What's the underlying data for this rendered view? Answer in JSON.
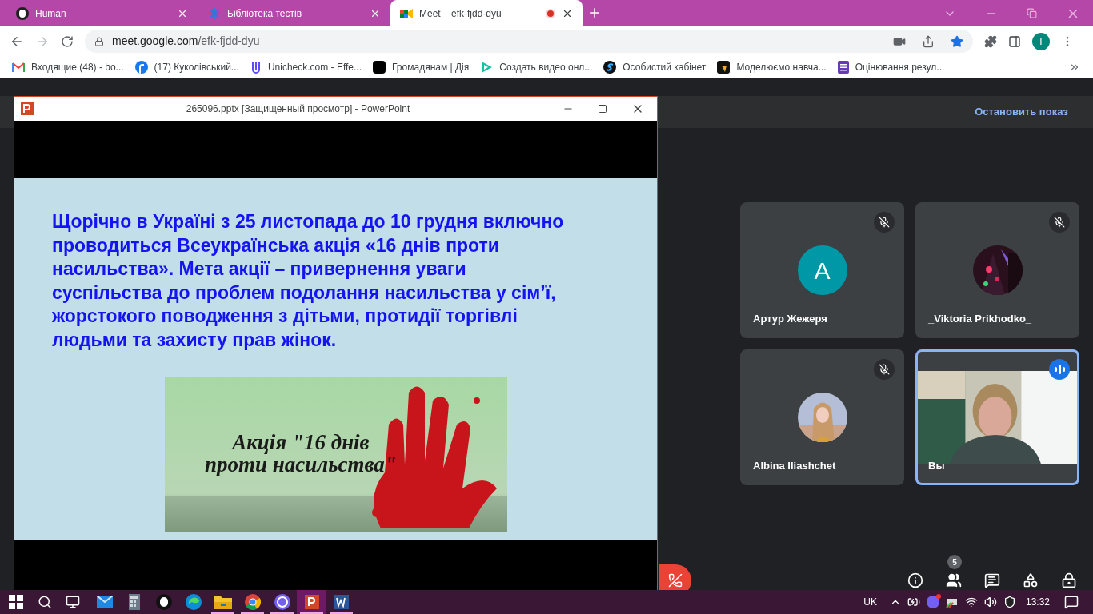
{
  "browser": {
    "tabs": [
      {
        "title": "Human",
        "selected": false,
        "recording": false
      },
      {
        "title": "Бібліотека тестів",
        "selected": false,
        "recording": false
      },
      {
        "title": "Meet – efk-fjdd-dyu",
        "selected": true,
        "recording": true
      }
    ],
    "address": {
      "host": "meet.google.com",
      "path": "/efk-fjdd-dyu"
    },
    "profile_initial": "T",
    "bookmarks": [
      {
        "label": "Входящие (48) - bo..."
      },
      {
        "label": "(17) Куколівський..."
      },
      {
        "label": "Unicheck.com - Effe..."
      },
      {
        "label": "Громадянам | Дія"
      },
      {
        "label": "Создать видео онл..."
      },
      {
        "label": "Особистий кабінет"
      },
      {
        "label": "Моделюємо навча..."
      },
      {
        "label": "Оцінювання резул..."
      }
    ]
  },
  "powerpoint": {
    "title": "265096.pptx [Защищенный просмотр] - PowerPoint",
    "slide": {
      "lines": [
        "Щорічно в Україні з 25 листопада до 10 грудня включно",
        "проводиться Всеукраїнська акція «16 днів проти",
        "насильства». Мета акції – привернення уваги",
        "суспільства до проблем подолання насильства у сім’ї,",
        "жорстокого поводження з дітьми, протидії торгівлі",
        "людьми та захисту прав жінок."
      ],
      "image_caption": [
        "Акція \"16 днів",
        "проти насильства\""
      ]
    }
  },
  "meet": {
    "stop_button": "Остановить показ",
    "participants": [
      {
        "name": "Артур Жежеря",
        "kind": "letter",
        "letter": "A",
        "muted": true,
        "speaking": false
      },
      {
        "name": "_Viktoria Prikhodko_",
        "muted": true,
        "speaking": false
      },
      {
        "name": "Albina Iliashchet",
        "muted": true,
        "speaking": false
      },
      {
        "name": "Вы",
        "kind": "video",
        "muted": false,
        "speaking": true
      }
    ],
    "people_count": "5"
  },
  "taskbar": {
    "apps": [
      {
        "open": false,
        "active": false
      },
      {
        "open": false,
        "active": false
      },
      {
        "open": false,
        "active": false
      },
      {
        "open": false,
        "active": false
      },
      {
        "open": true,
        "active": false
      },
      {
        "open": true,
        "active": false
      },
      {
        "open": true,
        "active": false
      },
      {
        "open": true,
        "active": true
      },
      {
        "open": true,
        "active": false
      }
    ],
    "language": "UK",
    "time": "13:32"
  }
}
